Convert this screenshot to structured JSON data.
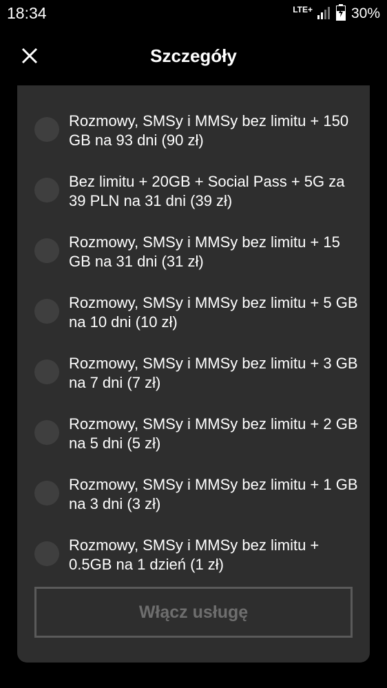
{
  "status_bar": {
    "time": "18:34",
    "network": "LTE+",
    "battery": "30%"
  },
  "header": {
    "title": "Szczegóły",
    "close_icon": "close-icon"
  },
  "options": [
    {
      "label": "Rozmowy, SMSy i MMSy bez limitu + 150 GB na 93 dni (90 zł)",
      "selected": false
    },
    {
      "label": "Bez limitu + 20GB + Social Pass + 5G za 39 PLN na 31 dni (39 zł)",
      "selected": false
    },
    {
      "label": "Rozmowy, SMSy i MMSy bez limitu + 15 GB na 31 dni (31 zł)",
      "selected": false
    },
    {
      "label": "Rozmowy, SMSy i MMSy bez limitu + 5 GB na 10 dni (10 zł)",
      "selected": false
    },
    {
      "label": "Rozmowy, SMSy i MMSy bez limitu + 3 GB na 7 dni (7 zł)",
      "selected": false
    },
    {
      "label": "Rozmowy, SMSy i MMSy bez limitu + 2 GB na 5 dni (5 zł)",
      "selected": false
    },
    {
      "label": "Rozmowy, SMSy i MMSy bez limitu + 1 GB na 3 dni (3 zł)",
      "selected": false
    },
    {
      "label": "Rozmowy, SMSy i MMSy bez limitu + 0.5GB na 1 dzień (1 zł)",
      "selected": false
    }
  ],
  "activate_button": {
    "label": "Włącz usługę",
    "enabled": false
  },
  "colors": {
    "background": "#000000",
    "card": "#2e2e2e",
    "radio": "#3f3f3f",
    "disabled_button_text": "#6e6e6e"
  }
}
